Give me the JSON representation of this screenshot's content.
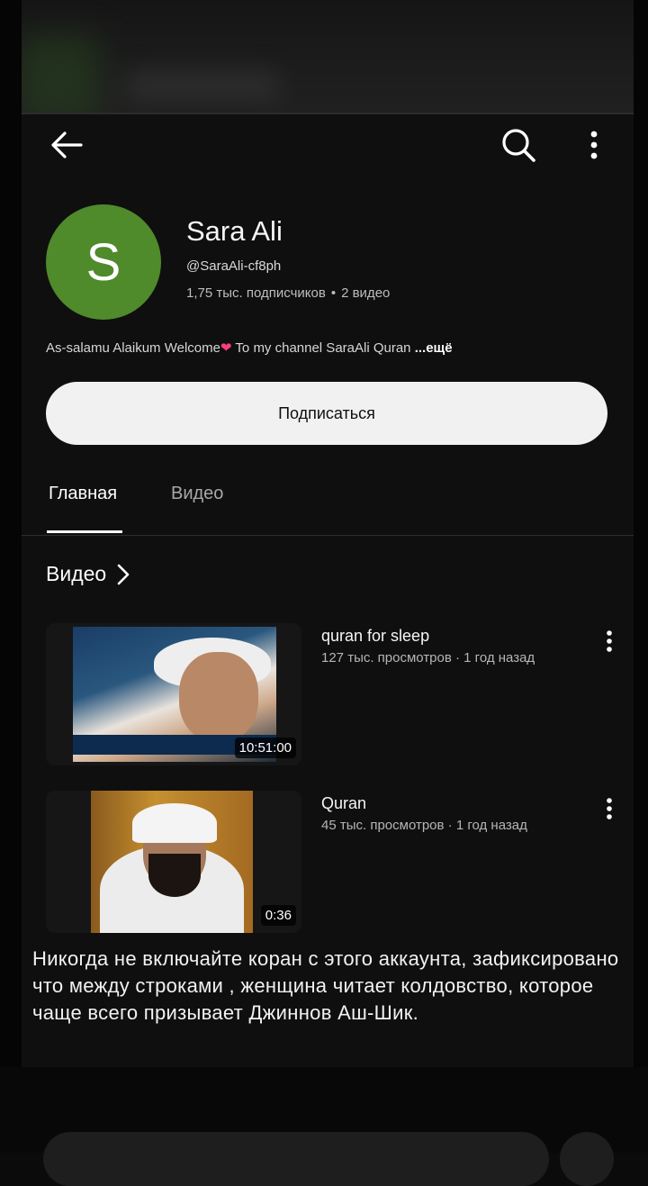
{
  "channel": {
    "avatar_letter": "S",
    "avatar_color": "#4f8a2b",
    "name": "Sara Ali",
    "handle": "@SaraAli-cf8ph",
    "subscribers": "1,75 тыс. подписчиков",
    "separator": "•",
    "video_count": "2 видео",
    "description_prefix": "As-salamu Alaikum Welcome",
    "description_heart": "❤",
    "description_suffix": " To my channel SaraAli Quran ",
    "description_more": "...ещё",
    "subscribe_label": "Подписаться"
  },
  "header": {
    "back_icon": "back-arrow-icon",
    "search_icon": "search-icon",
    "more_icon": "more-vert-icon"
  },
  "tabs": [
    {
      "label": "Главная",
      "active": true
    },
    {
      "label": "Видео",
      "active": false
    }
  ],
  "videos_section": {
    "title": "Видео",
    "items": [
      {
        "title": "quran for sleep",
        "meta": "127 тыс. просмотров · 1 год назад",
        "duration": "10:51:00"
      },
      {
        "title": "Quran",
        "meta": "45 тыс. просмотров · 1 год назад",
        "duration": "0:36"
      }
    ]
  },
  "overlay_caption": "Никогда не включайте коран с этого аккаунта, зафиксировано что между строками , женщина читает колдовство, которое чаще всего призывает Джиннов Аш-Шик."
}
